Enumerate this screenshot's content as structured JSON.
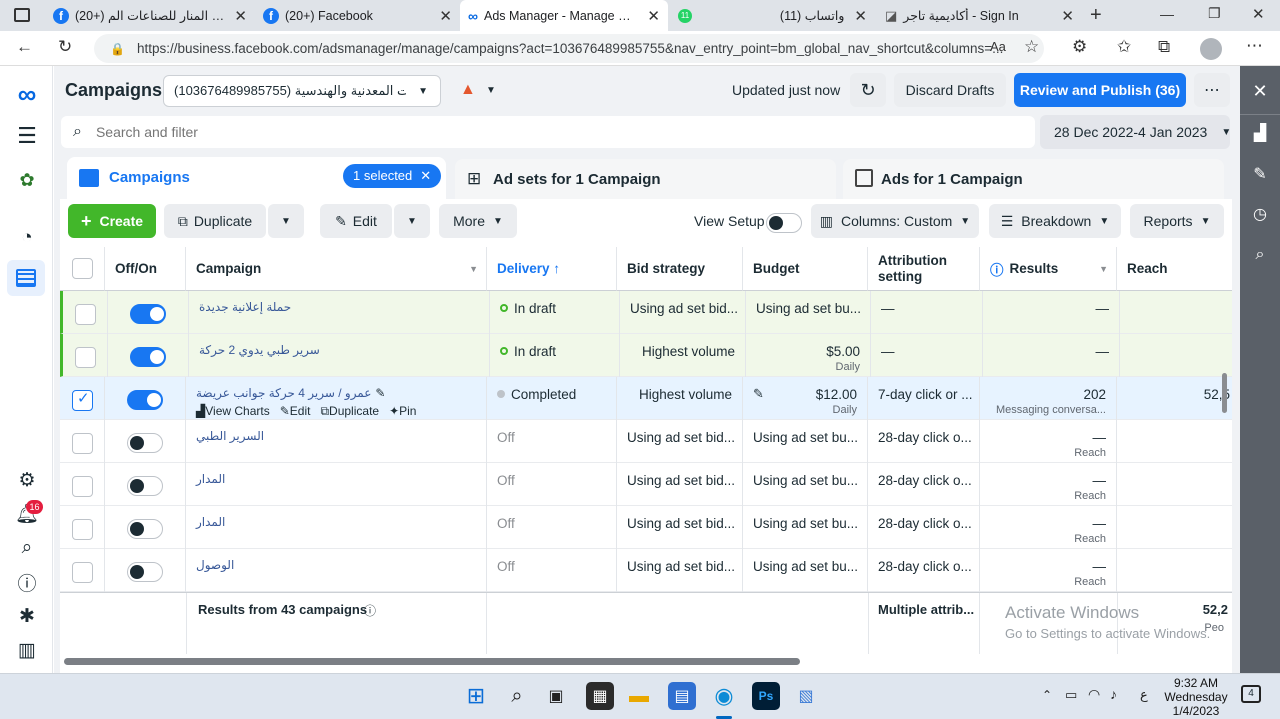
{
  "browser": {
    "tabs": [
      {
        "label": "(20+) شركة المنار للصناعات الم",
        "icon": "facebook-icon"
      },
      {
        "label": "(20+) Facebook",
        "icon": "facebook-icon"
      },
      {
        "label": "Ads Manager - Manage ads -",
        "icon": "meta-icon"
      },
      {
        "label": "(11) واتساب",
        "icon": "whatsapp-icon",
        "badge": "11"
      },
      {
        "label": "أكاديمية تاجر - Sign In",
        "icon": "page-icon"
      }
    ],
    "url": "https://business.facebook.com/adsmanager/manage/campaigns?act=103676489985755&nav_entry_point=bm_global_nav_shortcut&columns=..."
  },
  "header": {
    "title": "Campaigns",
    "account": "ـاعات المعدنية والهندسية (103676489985755)",
    "updated": "Updated just now",
    "discard": "Discard Drafts",
    "publish": "Review and Publish (36)"
  },
  "search": {
    "placeholder": "Search and filter",
    "date_range": "28 Dec 2022-4 Jan 2023"
  },
  "levels": {
    "campaigns": "Campaigns",
    "selected": "1 selected",
    "adsets": "Ad sets for 1 Campaign",
    "ads": "Ads for 1 Campaign"
  },
  "toolbar": {
    "create": "Create",
    "duplicate": "Duplicate",
    "edit": "Edit",
    "more": "More",
    "view_setup": "View Setup",
    "columns": "Columns: Custom",
    "breakdown": "Breakdown",
    "reports": "Reports"
  },
  "columns": {
    "offon": "Off/On",
    "campaign": "Campaign",
    "delivery": "Delivery ↑",
    "bid": "Bid strategy",
    "budget": "Budget",
    "attribution": "Attribution setting",
    "results": "Results",
    "reach": "Reach"
  },
  "rows": [
    {
      "name": "حملة إعلانية جديدة",
      "delivery": "In draft",
      "bid": "Using ad set bid...",
      "budget": "Using ad set bu...",
      "budget_sub": "",
      "attr": "—",
      "results": "—",
      "results_sub": "",
      "reach": ""
    },
    {
      "name": "سرير طبي يدوي 2 حركة",
      "delivery": "In draft",
      "bid": "Highest volume",
      "budget": "$5.00",
      "budget_sub": "Daily",
      "attr": "—",
      "results": "—",
      "results_sub": "",
      "reach": ""
    },
    {
      "name": "عمرو / سرير 4 حركة جوانب عريضة",
      "delivery": "Completed",
      "bid": "Highest volume",
      "budget": "$12.00",
      "budget_sub": "Daily",
      "attr": "7-day click or ...",
      "results": "202",
      "results_sub": "Messaging conversa...",
      "reach": "52,5"
    },
    {
      "name": "السرير الطبي",
      "delivery": "Off",
      "bid": "Using ad set bid...",
      "budget": "Using ad set bu...",
      "budget_sub": "",
      "attr": "28-day click o...",
      "results": "—",
      "results_sub": "Reach",
      "reach": ""
    },
    {
      "name": "المدار",
      "delivery": "Off",
      "bid": "Using ad set bid...",
      "budget": "Using ad set bu...",
      "budget_sub": "",
      "attr": "28-day click o...",
      "results": "—",
      "results_sub": "Reach",
      "reach": ""
    },
    {
      "name": "المدار",
      "delivery": "Off",
      "bid": "Using ad set bid...",
      "budget": "Using ad set bu...",
      "budget_sub": "",
      "attr": "28-day click o...",
      "results": "—",
      "results_sub": "Reach",
      "reach": ""
    },
    {
      "name": "الوصول",
      "delivery": "Off",
      "bid": "Using ad set bid...",
      "budget": "Using ad set bu...",
      "budget_sub": "",
      "attr": "28-day click o...",
      "results": "—",
      "results_sub": "Reach",
      "reach": ""
    }
  ],
  "row_actions": {
    "charts": "View Charts",
    "edit": "Edit",
    "duplicate": "Duplicate",
    "pin": "Pin"
  },
  "footer": {
    "summary": "Results from 43 campaigns",
    "attr": "Multiple attrib...",
    "reach": "52,2",
    "reach_sub": "Peo"
  },
  "watermark": {
    "line1": "Activate Windows",
    "line2": "Go to Settings to activate Windows."
  },
  "notifications_badge": "16",
  "taskbar": {
    "time": "9:32 AM",
    "day": "Wednesday",
    "date": "1/4/2023",
    "lang": "ع",
    "notif": "4"
  },
  "colors": {
    "accent": "#1877f2",
    "green": "#42b72a",
    "draft_dot": "#42b72a",
    "selected_row": "#e7f3ff",
    "draft_row": "#f1f8e9"
  }
}
